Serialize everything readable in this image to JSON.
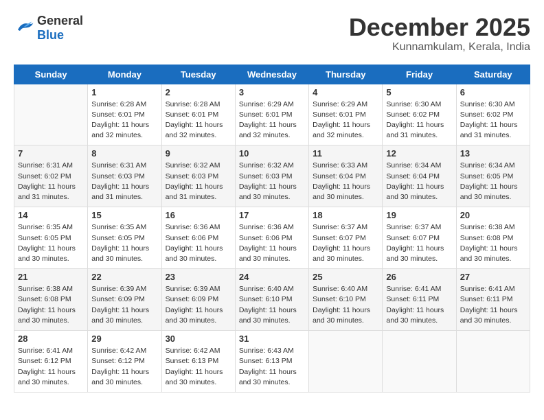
{
  "header": {
    "logo_general": "General",
    "logo_blue": "Blue",
    "month": "December 2025",
    "location": "Kunnamkulam, Kerala, India"
  },
  "days_of_week": [
    "Sunday",
    "Monday",
    "Tuesday",
    "Wednesday",
    "Thursday",
    "Friday",
    "Saturday"
  ],
  "weeks": [
    [
      {
        "day": "",
        "sunrise": "",
        "sunset": "",
        "daylight": ""
      },
      {
        "day": "1",
        "sunrise": "Sunrise: 6:28 AM",
        "sunset": "Sunset: 6:01 PM",
        "daylight": "Daylight: 11 hours and 32 minutes."
      },
      {
        "day": "2",
        "sunrise": "Sunrise: 6:28 AM",
        "sunset": "Sunset: 6:01 PM",
        "daylight": "Daylight: 11 hours and 32 minutes."
      },
      {
        "day": "3",
        "sunrise": "Sunrise: 6:29 AM",
        "sunset": "Sunset: 6:01 PM",
        "daylight": "Daylight: 11 hours and 32 minutes."
      },
      {
        "day": "4",
        "sunrise": "Sunrise: 6:29 AM",
        "sunset": "Sunset: 6:01 PM",
        "daylight": "Daylight: 11 hours and 32 minutes."
      },
      {
        "day": "5",
        "sunrise": "Sunrise: 6:30 AM",
        "sunset": "Sunset: 6:02 PM",
        "daylight": "Daylight: 11 hours and 31 minutes."
      },
      {
        "day": "6",
        "sunrise": "Sunrise: 6:30 AM",
        "sunset": "Sunset: 6:02 PM",
        "daylight": "Daylight: 11 hours and 31 minutes."
      }
    ],
    [
      {
        "day": "7",
        "sunrise": "Sunrise: 6:31 AM",
        "sunset": "Sunset: 6:02 PM",
        "daylight": "Daylight: 11 hours and 31 minutes."
      },
      {
        "day": "8",
        "sunrise": "Sunrise: 6:31 AM",
        "sunset": "Sunset: 6:03 PM",
        "daylight": "Daylight: 11 hours and 31 minutes."
      },
      {
        "day": "9",
        "sunrise": "Sunrise: 6:32 AM",
        "sunset": "Sunset: 6:03 PM",
        "daylight": "Daylight: 11 hours and 31 minutes."
      },
      {
        "day": "10",
        "sunrise": "Sunrise: 6:32 AM",
        "sunset": "Sunset: 6:03 PM",
        "daylight": "Daylight: 11 hours and 30 minutes."
      },
      {
        "day": "11",
        "sunrise": "Sunrise: 6:33 AM",
        "sunset": "Sunset: 6:04 PM",
        "daylight": "Daylight: 11 hours and 30 minutes."
      },
      {
        "day": "12",
        "sunrise": "Sunrise: 6:34 AM",
        "sunset": "Sunset: 6:04 PM",
        "daylight": "Daylight: 11 hours and 30 minutes."
      },
      {
        "day": "13",
        "sunrise": "Sunrise: 6:34 AM",
        "sunset": "Sunset: 6:05 PM",
        "daylight": "Daylight: 11 hours and 30 minutes."
      }
    ],
    [
      {
        "day": "14",
        "sunrise": "Sunrise: 6:35 AM",
        "sunset": "Sunset: 6:05 PM",
        "daylight": "Daylight: 11 hours and 30 minutes."
      },
      {
        "day": "15",
        "sunrise": "Sunrise: 6:35 AM",
        "sunset": "Sunset: 6:05 PM",
        "daylight": "Daylight: 11 hours and 30 minutes."
      },
      {
        "day": "16",
        "sunrise": "Sunrise: 6:36 AM",
        "sunset": "Sunset: 6:06 PM",
        "daylight": "Daylight: 11 hours and 30 minutes."
      },
      {
        "day": "17",
        "sunrise": "Sunrise: 6:36 AM",
        "sunset": "Sunset: 6:06 PM",
        "daylight": "Daylight: 11 hours and 30 minutes."
      },
      {
        "day": "18",
        "sunrise": "Sunrise: 6:37 AM",
        "sunset": "Sunset: 6:07 PM",
        "daylight": "Daylight: 11 hours and 30 minutes."
      },
      {
        "day": "19",
        "sunrise": "Sunrise: 6:37 AM",
        "sunset": "Sunset: 6:07 PM",
        "daylight": "Daylight: 11 hours and 30 minutes."
      },
      {
        "day": "20",
        "sunrise": "Sunrise: 6:38 AM",
        "sunset": "Sunset: 6:08 PM",
        "daylight": "Daylight: 11 hours and 30 minutes."
      }
    ],
    [
      {
        "day": "21",
        "sunrise": "Sunrise: 6:38 AM",
        "sunset": "Sunset: 6:08 PM",
        "daylight": "Daylight: 11 hours and 30 minutes."
      },
      {
        "day": "22",
        "sunrise": "Sunrise: 6:39 AM",
        "sunset": "Sunset: 6:09 PM",
        "daylight": "Daylight: 11 hours and 30 minutes."
      },
      {
        "day": "23",
        "sunrise": "Sunrise: 6:39 AM",
        "sunset": "Sunset: 6:09 PM",
        "daylight": "Daylight: 11 hours and 30 minutes."
      },
      {
        "day": "24",
        "sunrise": "Sunrise: 6:40 AM",
        "sunset": "Sunset: 6:10 PM",
        "daylight": "Daylight: 11 hours and 30 minutes."
      },
      {
        "day": "25",
        "sunrise": "Sunrise: 6:40 AM",
        "sunset": "Sunset: 6:10 PM",
        "daylight": "Daylight: 11 hours and 30 minutes."
      },
      {
        "day": "26",
        "sunrise": "Sunrise: 6:41 AM",
        "sunset": "Sunset: 6:11 PM",
        "daylight": "Daylight: 11 hours and 30 minutes."
      },
      {
        "day": "27",
        "sunrise": "Sunrise: 6:41 AM",
        "sunset": "Sunset: 6:11 PM",
        "daylight": "Daylight: 11 hours and 30 minutes."
      }
    ],
    [
      {
        "day": "28",
        "sunrise": "Sunrise: 6:41 AM",
        "sunset": "Sunset: 6:12 PM",
        "daylight": "Daylight: 11 hours and 30 minutes."
      },
      {
        "day": "29",
        "sunrise": "Sunrise: 6:42 AM",
        "sunset": "Sunset: 6:12 PM",
        "daylight": "Daylight: 11 hours and 30 minutes."
      },
      {
        "day": "30",
        "sunrise": "Sunrise: 6:42 AM",
        "sunset": "Sunset: 6:13 PM",
        "daylight": "Daylight: 11 hours and 30 minutes."
      },
      {
        "day": "31",
        "sunrise": "Sunrise: 6:43 AM",
        "sunset": "Sunset: 6:13 PM",
        "daylight": "Daylight: 11 hours and 30 minutes."
      },
      {
        "day": "",
        "sunrise": "",
        "sunset": "",
        "daylight": ""
      },
      {
        "day": "",
        "sunrise": "",
        "sunset": "",
        "daylight": ""
      },
      {
        "day": "",
        "sunrise": "",
        "sunset": "",
        "daylight": ""
      }
    ]
  ]
}
